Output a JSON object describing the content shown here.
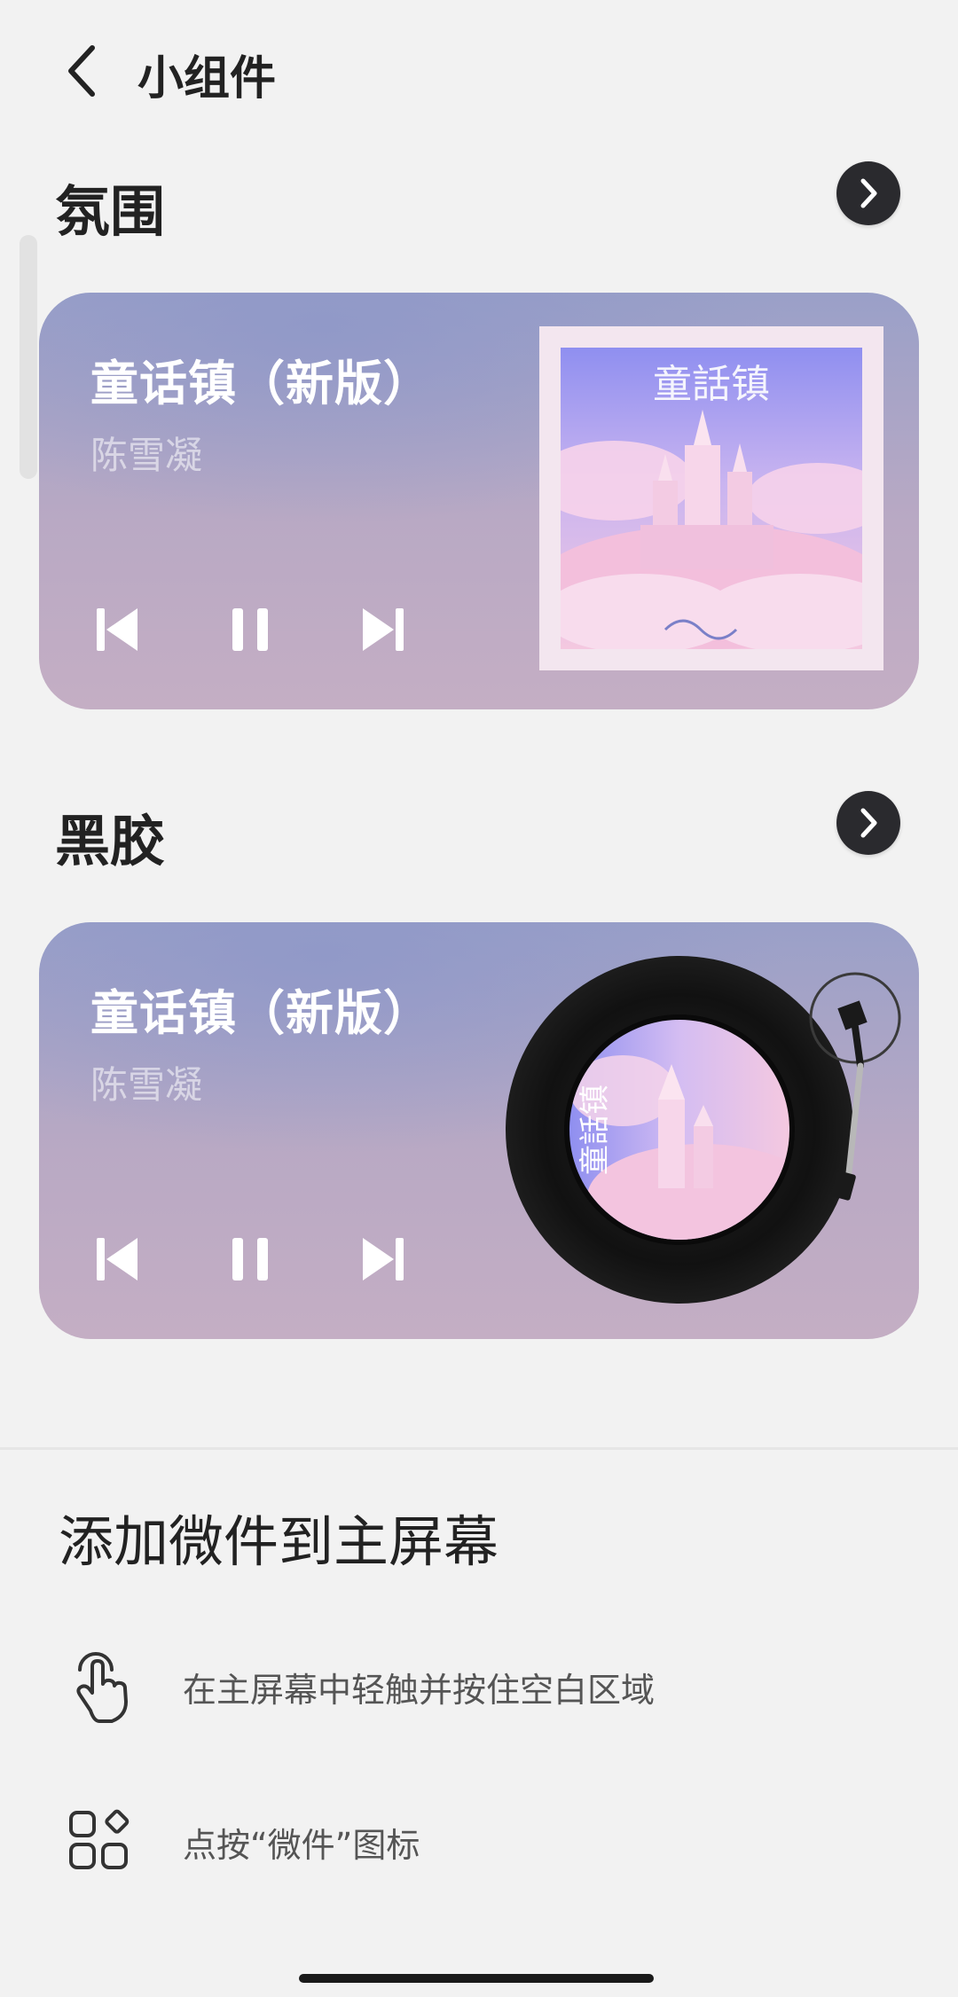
{
  "header": {
    "title": "小组件"
  },
  "sections": [
    {
      "title": "氛围",
      "card": {
        "song_title": "童话镇（新版）",
        "artist": "陈雪凝",
        "album_text": "童話镇"
      }
    },
    {
      "title": "黑胶",
      "card": {
        "song_title": "童话镇（新版）",
        "artist": "陈雪凝",
        "album_text": "童話镇"
      }
    }
  ],
  "add_section": {
    "title": "添加微件到主屏幕",
    "instructions": [
      {
        "icon": "touch-hold-icon",
        "text": "在主屏幕中轻触并按住空白区域"
      },
      {
        "icon": "widgets-icon",
        "text": "点按“微件”图标"
      }
    ]
  },
  "colors": {
    "background": "#f2f2f2",
    "arrow_button": "#2a2a2e",
    "card_top": "#9aa0c8",
    "card_bottom": "#c4aec4"
  }
}
